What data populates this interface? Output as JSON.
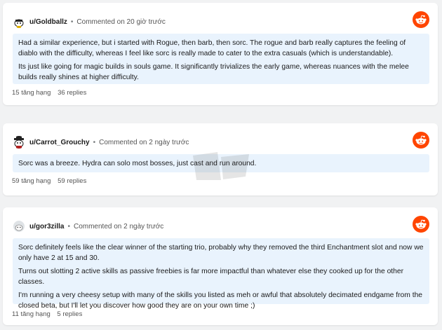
{
  "comments": [
    {
      "username": "u/Goldballz",
      "separator": "•",
      "time": "Commented on 20 giờ trước",
      "paragraphs": [
        "Had a similar experience, but i started with Rogue, then barb, then sorc. The rogue and barb really captures the feeling of diablo with the difficulty, whereas I feel like sorc is really made to cater to the extra casuals (which is understandable).",
        "Its just like going for magic builds in souls game. It significantly trivializes the early game, whereas nuances with the melee builds really shines at higher difficulty."
      ],
      "votes": "15 tăng hạng",
      "replies": "36 replies"
    },
    {
      "username": "u/Carrot_Grouchy",
      "separator": "•",
      "time": "Commented on 2 ngày trước",
      "paragraphs": [
        "Sorc was a breeze. Hydra can solo most bosses, just cast and run around."
      ],
      "votes": "59 tăng hạng",
      "replies": "59 replies"
    },
    {
      "username": "u/gor3zilla",
      "separator": "•",
      "time": "Commented on 2 ngày trước",
      "paragraphs": [
        "Sorc definitely feels like the clear winner of the starting trio, probably why they removed the third Enchantment slot and now we only have 2 at 15 and 30.",
        "Turns out slotting 2 active skills as passive freebies is far more impactful than whatever else they cooked up for the other classes.",
        "I'm running a very cheesy setup with many of the skills you listed as meh or awful that absolutely decimated endgame from the closed beta, but I'll let you discover how good they are on your own time ;)"
      ],
      "votes": "11 tăng hạng",
      "replies": "5 replies"
    }
  ],
  "colors": {
    "reddit_orange": "#ff4500",
    "comment_bg": "#e9f3fd",
    "page_bg": "#f1f2f3"
  },
  "icons": {
    "logo": "reddit-logo-icon",
    "avatar": "snoo-avatar-icon"
  }
}
